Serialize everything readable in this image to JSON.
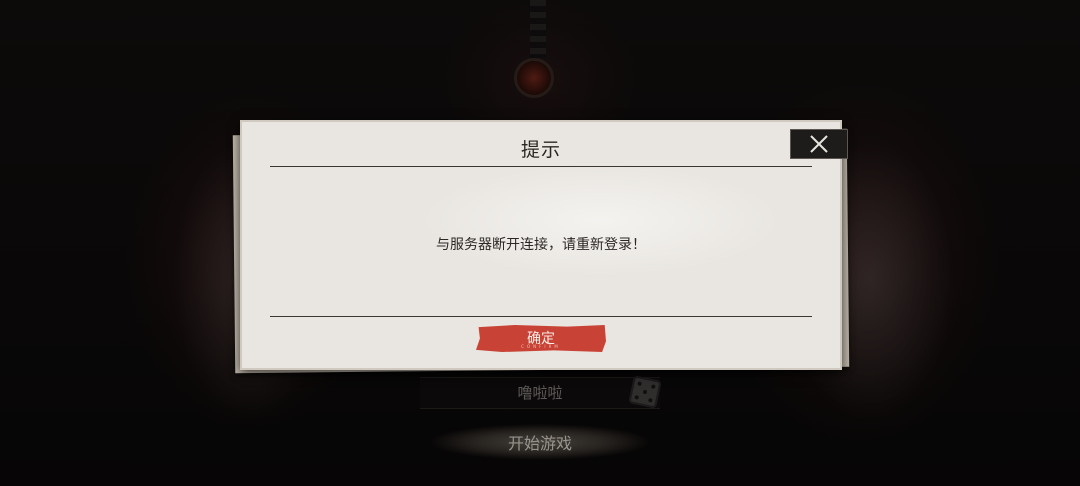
{
  "dialog": {
    "title": "提示",
    "message": "与服务器断开连接，请重新登录！",
    "confirm_label": "确定",
    "confirm_sub": "CONFIRM",
    "close_icon": "close-icon"
  },
  "background": {
    "player_name": "噜啦啦",
    "start_label": "开始游戏",
    "dice_icon": "dice-icon"
  },
  "colors": {
    "confirm_red": "#c94236",
    "paper": "#e9e6e1",
    "backdrop": "#0d0b0b"
  }
}
